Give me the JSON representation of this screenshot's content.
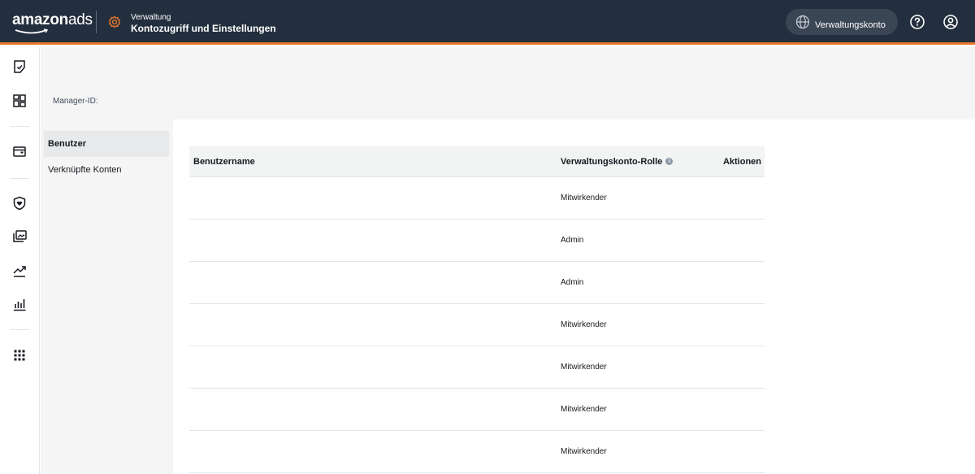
{
  "header": {
    "logo_main": "amazon",
    "logo_ads": "ads",
    "section_label": "Verwaltung",
    "page_title": "Kontozugriff und Einstellungen",
    "account_label": "Verwaltungskonto"
  },
  "manager_id_label": "Manager-ID:",
  "subnav": {
    "items": [
      {
        "label": "Benutzer",
        "active": true
      },
      {
        "label": "Verknüpfte Konten",
        "active": false
      }
    ]
  },
  "table": {
    "columns": {
      "user": "Benutzername",
      "role": "Verwaltungskonto-Rolle",
      "actions": "Aktionen"
    },
    "rows": [
      {
        "user": "",
        "role": "Mitwirkender"
      },
      {
        "user": "",
        "role": "Admin"
      },
      {
        "user": "",
        "role": "Admin"
      },
      {
        "user": "",
        "role": "Mitwirkender"
      },
      {
        "user": "",
        "role": "Mitwirkender"
      },
      {
        "user": "",
        "role": "Mitwirkender"
      },
      {
        "user": "",
        "role": "Mitwirkender"
      }
    ]
  },
  "colors": {
    "header_bg": "#232f3e",
    "accent_orange": "#e8762d"
  },
  "icons": {
    "rail": [
      "checklist-icon",
      "dashboard-icon",
      "wallet-icon",
      "shield-heart-icon",
      "gallery-icon",
      "trend-icon",
      "bar-chart-icon",
      "apps-grid-icon"
    ]
  }
}
